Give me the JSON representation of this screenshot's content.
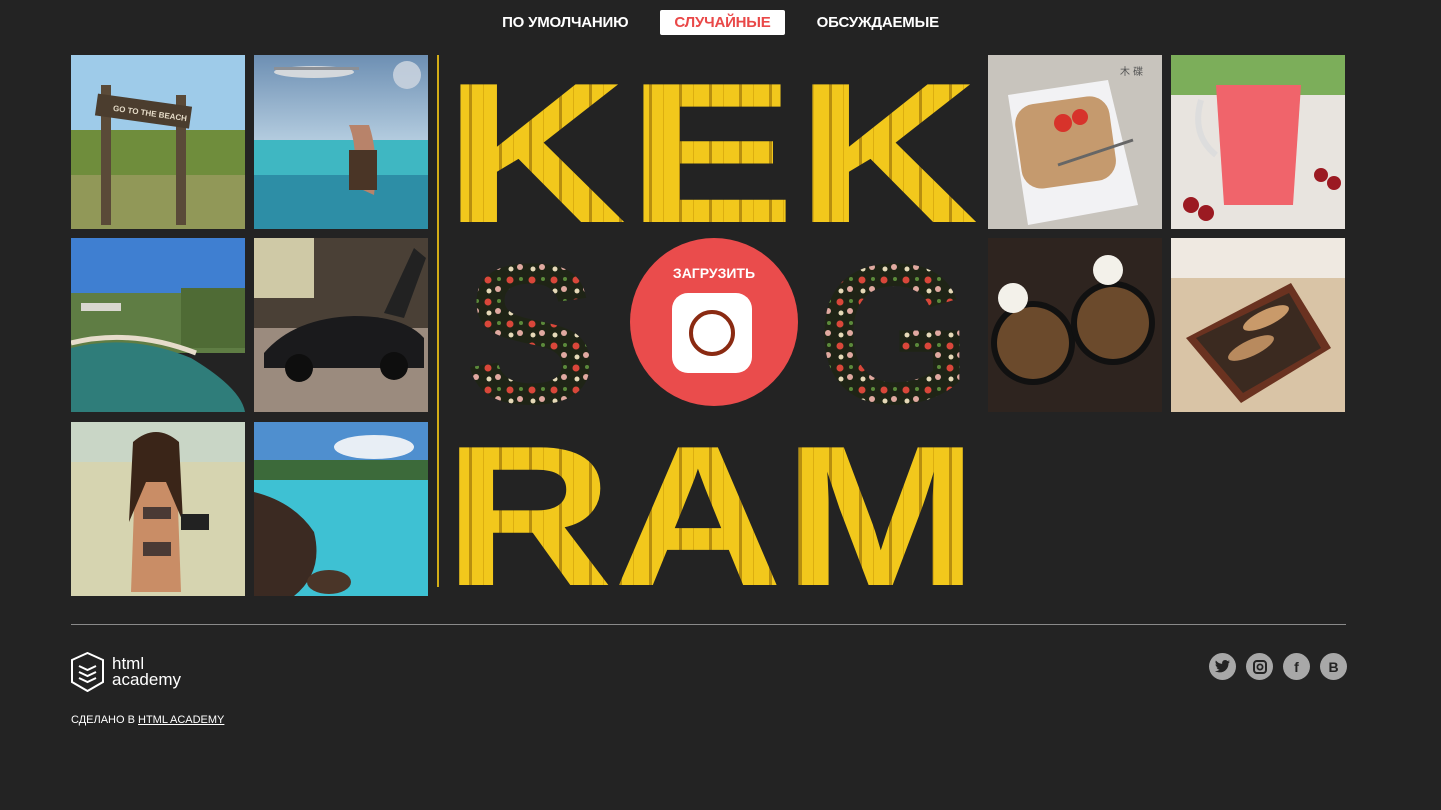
{
  "filters": {
    "default_label": "ПО УМОЛЧАНИЮ",
    "random_label": "СЛУЧАЙНЫЕ",
    "discussed_label": "ОБСУЖДАЕМЫЕ",
    "active": "random"
  },
  "logo": {
    "line1": "KEK",
    "line2_left": "S",
    "line2_right": "G",
    "line3": "RAM"
  },
  "upload": {
    "label": "ЗАГРУЗИТЬ"
  },
  "pictures": [
    {
      "subject": "beach sign",
      "sign_text": "GO TO THE BEACH"
    },
    {
      "subject": "airplane over beach"
    },
    {
      "subject": "lake shore"
    },
    {
      "subject": "black sports car"
    },
    {
      "subject": "woman on beach with camera"
    },
    {
      "subject": "rocky turquoise bay"
    },
    {
      "subject": "strawberries on plate",
      "caption": "木 碟"
    },
    {
      "subject": "red drink in jug"
    },
    {
      "subject": "curry bowls with rice bears"
    },
    {
      "subject": "shoe rack"
    }
  ],
  "footer": {
    "brand_line1": "html",
    "brand_line2": "academy",
    "made_prefix": "СДЕЛАНО В ",
    "made_link": "HTML ACADEMY"
  },
  "social": [
    "twitter-icon",
    "instagram-icon",
    "facebook-icon",
    "vk-icon"
  ],
  "social_glyphs": {
    "facebook": "f",
    "vk": "B"
  },
  "colors": {
    "background": "#232323",
    "accent": "#ea4c4c",
    "active_filter_text": "#e94848",
    "logo_yellow": "#f2c81c"
  }
}
